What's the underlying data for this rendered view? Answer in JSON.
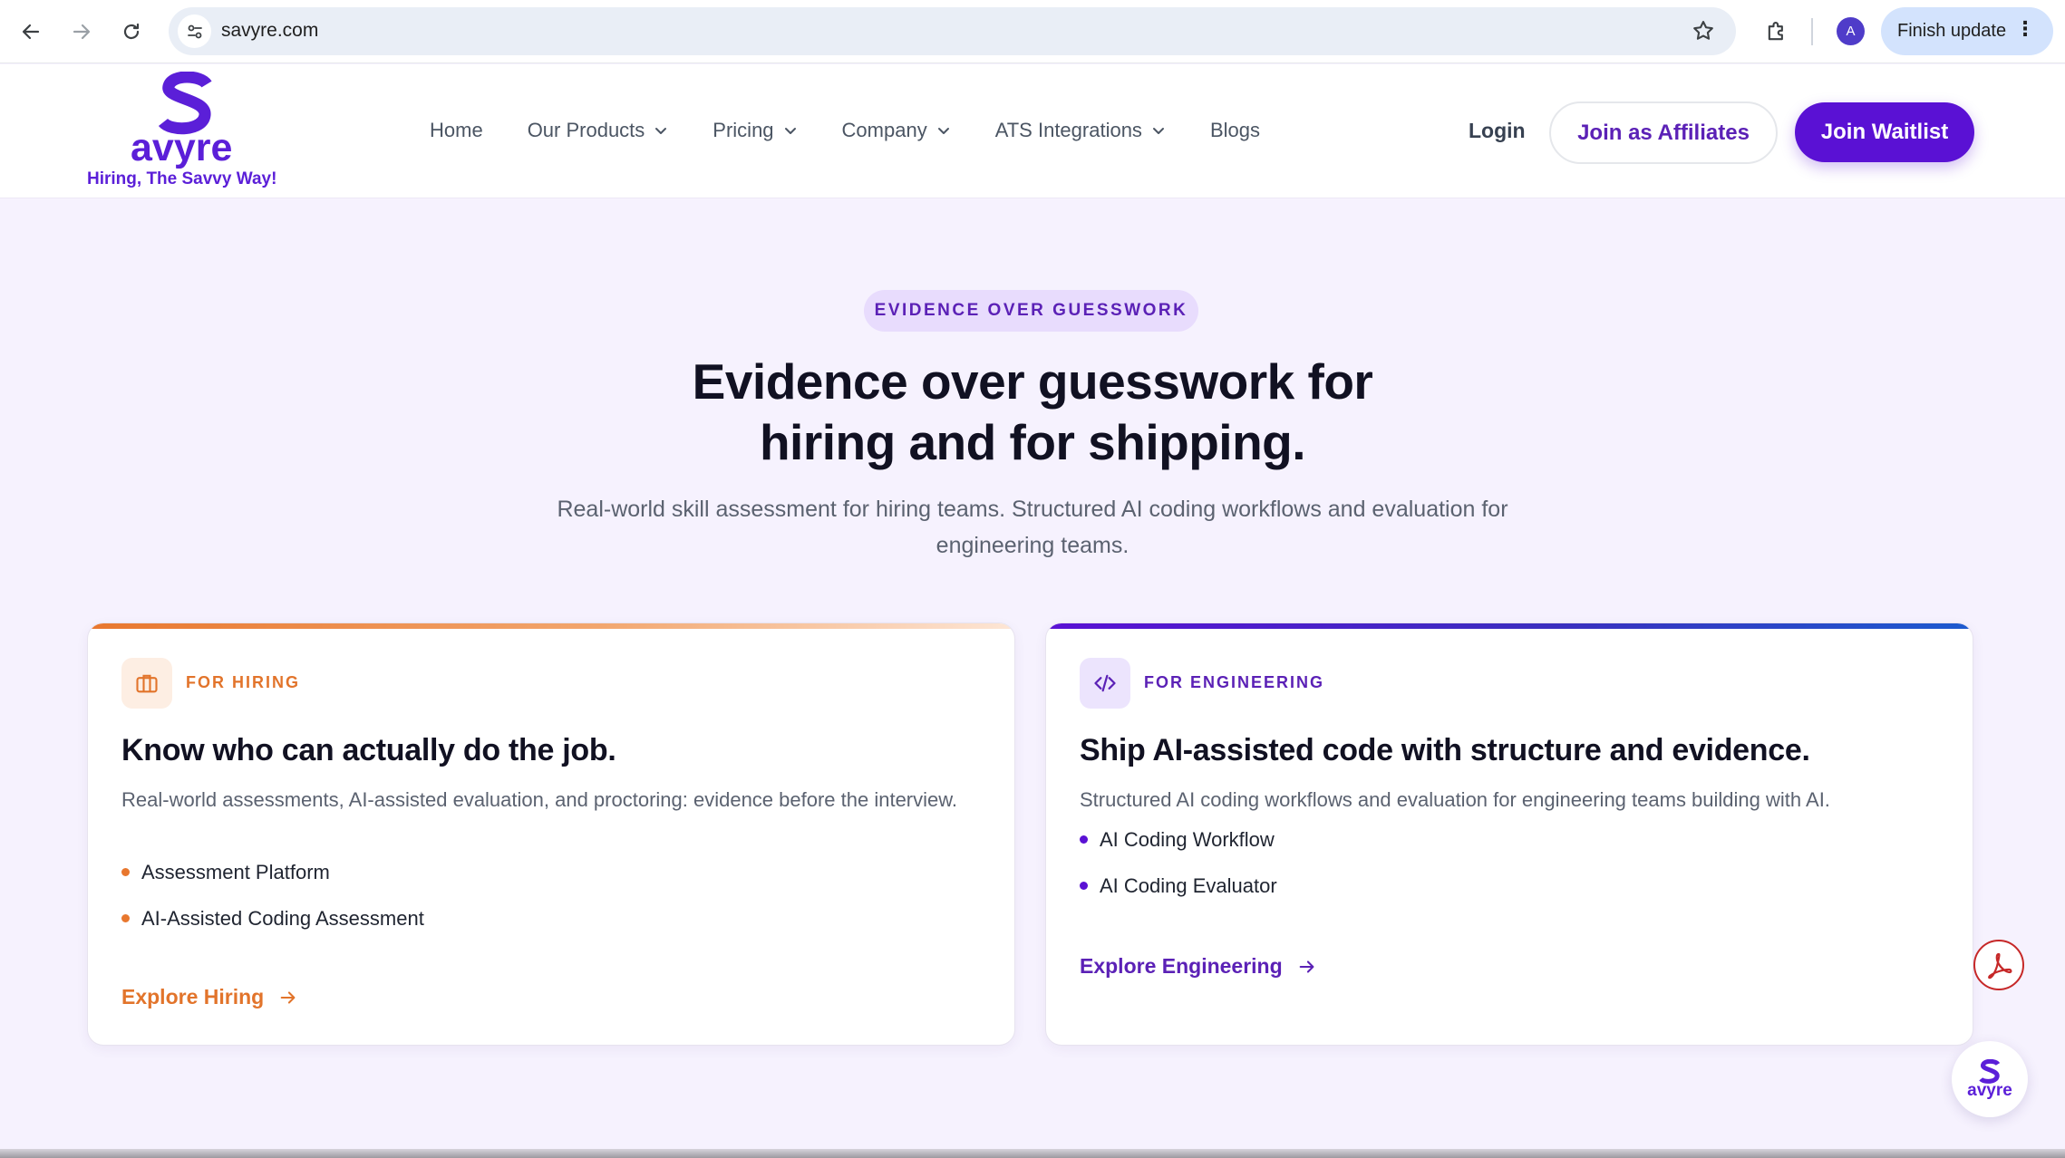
{
  "browser": {
    "url": "savyre.com",
    "profile_initial": "A",
    "update_label": "Finish update"
  },
  "site": {
    "logo_word": "avyre",
    "logo_tagline": "Hiring, The Savvy Way!",
    "nav": [
      {
        "label": "Home",
        "has_dropdown": false
      },
      {
        "label": "Our Products",
        "has_dropdown": true
      },
      {
        "label": "Pricing",
        "has_dropdown": true
      },
      {
        "label": "Company",
        "has_dropdown": true
      },
      {
        "label": "ATS Integrations",
        "has_dropdown": true
      },
      {
        "label": "Blogs",
        "has_dropdown": false
      }
    ],
    "login_label": "Login",
    "affiliates_label": "Join as Affiliates",
    "waitlist_label": "Join Waitlist"
  },
  "hero": {
    "eyebrow": "EVIDENCE OVER GUESSWORK",
    "title_line1": "Evidence over guesswork for",
    "title_line2": "hiring and for shipping.",
    "subtitle": "Real-world skill assessment for hiring teams. Structured AI coding workflows and evaluation for engineering teams."
  },
  "cards": {
    "hiring": {
      "icon": "briefcase-icon",
      "kicker": "FOR HIRING",
      "title": "Know who can actually do the job.",
      "description": "Real-world assessments, AI-assisted evaluation, and proctoring: evidence before the interview.",
      "items": [
        "Assessment Platform",
        "AI-Assisted Coding Assessment"
      ],
      "link": "Explore Hiring"
    },
    "engineering": {
      "icon": "code-icon",
      "kicker": "FOR ENGINEERING",
      "title": "Ship AI-assisted code with structure and evidence.",
      "description": "Structured AI coding workflows and evaluation for engineering teams building with AI.",
      "items": [
        "AI Coding Workflow",
        "AI Coding Evaluator"
      ],
      "link": "Explore Engineering"
    }
  },
  "widgets": {
    "chat_word": "avyre"
  },
  "colors": {
    "brand": "#5a11d4",
    "hiring_accent": "#e2742b",
    "page_bg": "#f6f2fe"
  }
}
